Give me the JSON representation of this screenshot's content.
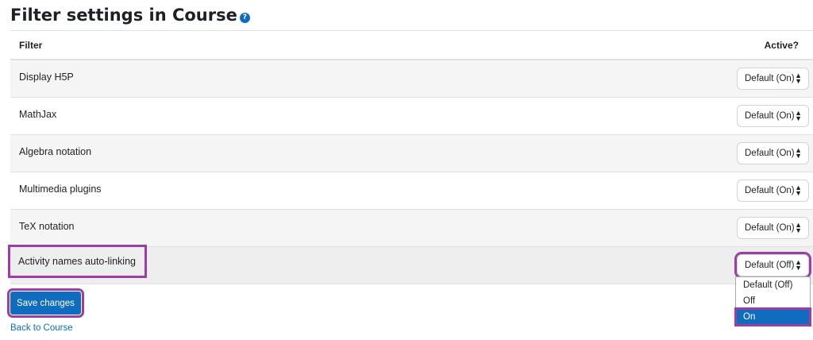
{
  "page": {
    "title": "Filter settings in Course",
    "help_icon": "question-circle-icon"
  },
  "table": {
    "headers": {
      "filter": "Filter",
      "active": "Active?"
    },
    "rows": [
      {
        "name": "Display H5P",
        "value": "Default (On)"
      },
      {
        "name": "MathJax",
        "value": "Default (On)"
      },
      {
        "name": "Algebra notation",
        "value": "Default (On)"
      },
      {
        "name": "Multimedia plugins",
        "value": "Default (On)"
      },
      {
        "name": "TeX notation",
        "value": "Default (On)"
      },
      {
        "name": "Activity names auto-linking",
        "value": "Default (Off)"
      }
    ]
  },
  "dropdown": {
    "options": [
      "Default (Off)",
      "Off",
      "On"
    ],
    "highlighted": "On"
  },
  "actions": {
    "save_label": "Save changes",
    "back_label": "Back to Course"
  },
  "colors": {
    "accent": "#0f6cbf",
    "highlight": "#9b3fa6",
    "stripe": "#f5f5f5"
  }
}
